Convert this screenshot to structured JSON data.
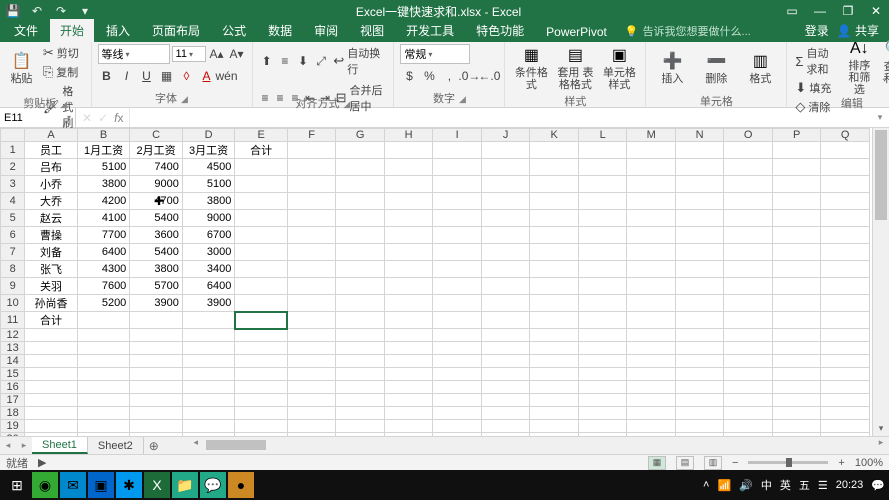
{
  "title": "Excel一键快速求和.xlsx - Excel",
  "tabs": {
    "file": "文件",
    "home": "开始",
    "insert": "插入",
    "layout": "页面布局",
    "formulas": "公式",
    "data": "数据",
    "review": "审阅",
    "view": "视图",
    "dev": "开发工具",
    "special": "特色功能",
    "powerpivot": "PowerPivot",
    "tell": "告诉我您想要做什么...",
    "login": "登录",
    "share": "共享"
  },
  "ribbon": {
    "clipboard": {
      "paste": "粘贴",
      "cut": "剪切",
      "copy": "复制",
      "formatpainter": "格式刷",
      "label": "剪贴板"
    },
    "font": {
      "name": "等线",
      "size": "11",
      "label": "字体"
    },
    "alignment": {
      "merge": "合并后居中",
      "wrap": "自动换行",
      "label": "对齐方式"
    },
    "number": {
      "format": "常规",
      "label": "数字"
    },
    "styles": {
      "cond": "条件格式",
      "table": "套用\n表格格式",
      "cell": "单元格样式",
      "label": "样式"
    },
    "cells": {
      "insert": "插入",
      "delete": "删除",
      "format": "格式",
      "label": "单元格"
    },
    "editing": {
      "autosum": "自动求和",
      "fill": "填充",
      "clear": "清除",
      "sortfilter": "排序和筛选",
      "findselect": "查找和选择",
      "label": "编辑"
    }
  },
  "namebox": "E11",
  "columns": [
    "A",
    "B",
    "C",
    "D",
    "E",
    "F",
    "G",
    "H",
    "I",
    "J",
    "K",
    "L",
    "M",
    "N",
    "O",
    "P",
    "Q"
  ],
  "rowcount": 23,
  "sheet": {
    "headers": [
      "员工",
      "1月工资",
      "2月工资",
      "3月工资",
      "合计"
    ],
    "rows": [
      [
        "吕布",
        "5100",
        "7400",
        "4500"
      ],
      [
        "小乔",
        "3800",
        "9000",
        "5100"
      ],
      [
        "大乔",
        "4200",
        "4700",
        "3800"
      ],
      [
        "赵云",
        "4100",
        "5400",
        "9000"
      ],
      [
        "曹操",
        "7700",
        "3600",
        "6700"
      ],
      [
        "刘备",
        "6400",
        "5400",
        "3000"
      ],
      [
        "张飞",
        "4300",
        "3800",
        "3400"
      ],
      [
        "关羽",
        "7600",
        "5700",
        "6400"
      ],
      [
        "孙尚香",
        "5200",
        "3900",
        "3900"
      ]
    ],
    "total_label": "合计"
  },
  "sheettabs": {
    "s1": "Sheet1",
    "s2": "Sheet2"
  },
  "status": {
    "ready": "就绪",
    "rec": "",
    "zoom": "100%"
  },
  "tray": {
    "ime1": "中",
    "ime2": "英",
    "ime3": "五",
    "time": "20:23",
    "date": ""
  }
}
